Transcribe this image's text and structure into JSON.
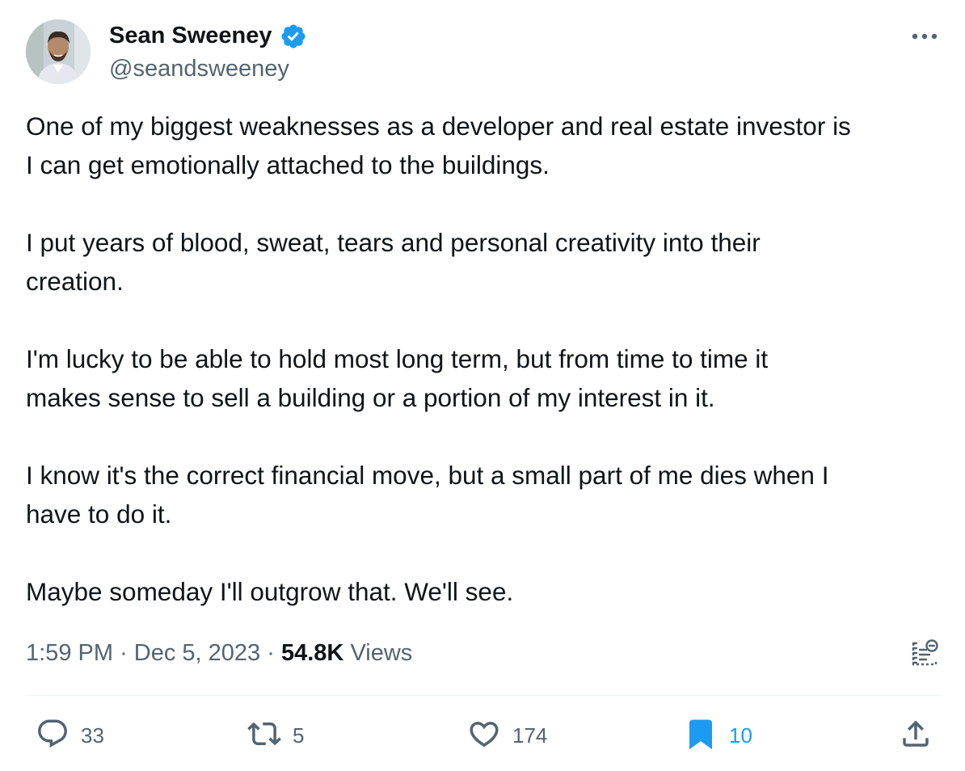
{
  "author": {
    "display_name": "Sean Sweeney",
    "handle": "@seandsweeney",
    "verified": true,
    "verified_color": "#1d9bf0"
  },
  "tweet": {
    "paragraphs": [
      "One of my biggest weaknesses as a developer and real estate investor is\nI can get emotionally attached to the buildings.",
      "I put years of blood, sweat, tears and personal creativity into their\ncreation.",
      "I'm lucky to be able to hold most long term, but from time to time it\nmakes sense to sell a building or a portion of my interest in it.",
      "I know it's the correct financial move, but a small part of me dies when I\nhave to do it.",
      "Maybe someday I'll outgrow that.  We'll see."
    ]
  },
  "meta": {
    "time": "1:59 PM",
    "separator": "·",
    "date": "Dec 5, 2023",
    "views_count": "54.8K",
    "views_label": "Views"
  },
  "actions": {
    "reply_count": "33",
    "retweet_count": "5",
    "like_count": "174",
    "bookmark_count": "10",
    "bookmarked": true
  },
  "icons": {
    "more": "more-horizontal-icon",
    "analytics": "view-analytics-icon",
    "reply": "reply-icon",
    "retweet": "retweet-icon",
    "like": "heart-icon",
    "bookmark": "bookmark-icon",
    "share": "share-icon"
  },
  "colors": {
    "text_primary": "#0f1419",
    "text_secondary": "#536471",
    "accent": "#1d9bf0",
    "divider": "#eff3f4"
  }
}
